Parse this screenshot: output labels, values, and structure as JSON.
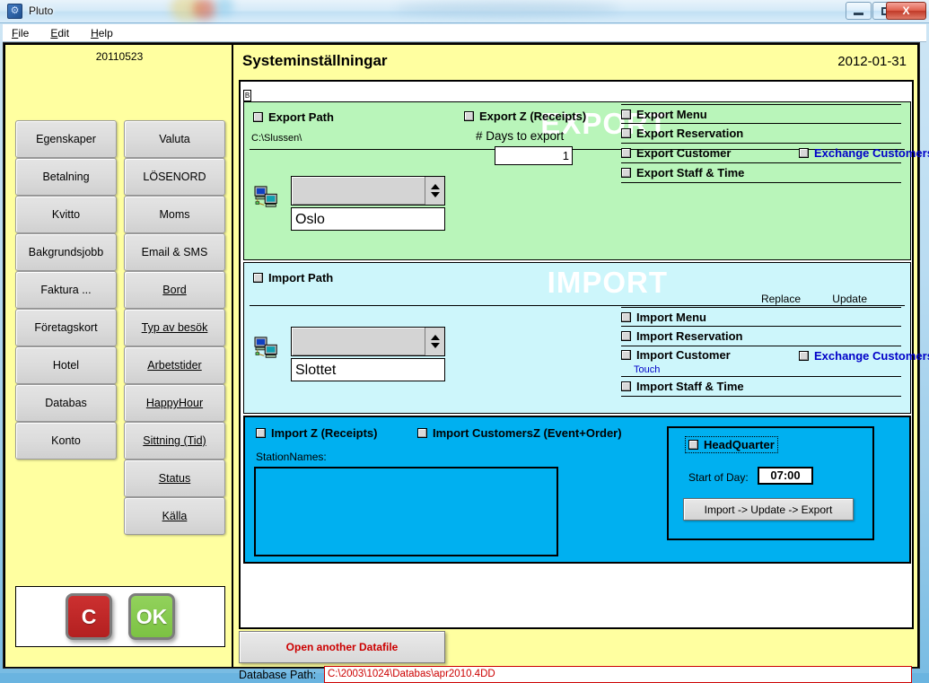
{
  "window": {
    "title": "Pluto",
    "app_icon": "gear-window-icon",
    "minimize": "–",
    "maximize": "□",
    "close": "X"
  },
  "menubar": {
    "items": [
      {
        "label": "File",
        "accel": "F"
      },
      {
        "label": "Edit",
        "accel": "E"
      },
      {
        "label": "Help",
        "accel": "H"
      }
    ]
  },
  "sidebar": {
    "date_code": "20110523",
    "buttons": [
      {
        "label": "Egenskaper",
        "underline": false
      },
      {
        "label": "Valuta",
        "underline": false
      },
      {
        "label": "Betalning",
        "underline": false
      },
      {
        "label": "LÖSENORD",
        "underline": false
      },
      {
        "label": "Kvitto",
        "underline": false
      },
      {
        "label": "Moms",
        "underline": false
      },
      {
        "label": "Bakgrundsjobb",
        "underline": false
      },
      {
        "label": "Email & SMS",
        "underline": false
      },
      {
        "label": "Faktura ...",
        "underline": false
      },
      {
        "label": "Bord",
        "underline": true
      },
      {
        "label": "Företagskort",
        "underline": false
      },
      {
        "label": "Typ av besök",
        "underline": true
      },
      {
        "label": "Hotel",
        "underline": false
      },
      {
        "label": "Arbetstider",
        "underline": true
      },
      {
        "label": "Databas",
        "underline": false
      },
      {
        "label": "HappyHour",
        "underline": true
      },
      {
        "label": "Konto",
        "underline": false
      },
      {
        "label": "Sittning (Tid)",
        "underline": true
      },
      {
        "label": "",
        "underline": false,
        "empty": true
      },
      {
        "label": "Status",
        "underline": true
      },
      {
        "label": "",
        "underline": false,
        "empty": true
      },
      {
        "label": "Källa",
        "underline": true
      }
    ],
    "cancel_button": "C",
    "ok_button": "OK"
  },
  "page": {
    "title": "Systeminställningar",
    "date": "2012-01-31",
    "tab_marker": "B"
  },
  "export": {
    "watermark": "EXPORT",
    "path_checkbox_label": "Export Path",
    "path_value": "C:\\Slussen\\",
    "station_combo_value": "",
    "station_name": "Oslo",
    "network_icon": "network-computers-icon",
    "export_z_label": "Export Z (Receipts)",
    "days_label": "# Days to export",
    "days_value": "1",
    "checklist": [
      {
        "label": "Export Menu",
        "extra": null
      },
      {
        "label": "Export Reservation",
        "extra": null
      },
      {
        "label": "Export Customer",
        "extra": "Exchange Customers"
      },
      {
        "label": "Export Staff & Time",
        "extra": null
      }
    ]
  },
  "import": {
    "watermark": "IMPORT",
    "path_checkbox_label": "Import Path",
    "station_combo_value": "",
    "station_name": "Slottet",
    "network_icon": "network-computers-icon",
    "col_replace": "Replace",
    "col_update": "Update",
    "checklist": [
      {
        "label": "Import Menu",
        "extra": null,
        "note": null
      },
      {
        "label": "Import Reservation",
        "extra": null,
        "note": null
      },
      {
        "label": "Import Customer",
        "extra": "Exchange Customers",
        "note": "Touch"
      },
      {
        "label": "Import Staff & Time",
        "extra": null,
        "note": null
      }
    ]
  },
  "blue_panel": {
    "import_z_label": "Import Z (Receipts)",
    "import_customersz_label": "Import CustomersZ (Event+Order)",
    "station_names_label": "StationNames:",
    "station_names_value": "",
    "headquarter": {
      "checkbox_label": "HeadQuarter",
      "start_of_day_label": "Start of Day:",
      "start_of_day_value": "07:00",
      "action_button": "Import -> Update -> Export"
    }
  },
  "bottom": {
    "open_datafile_button": "Open another Datafile",
    "db_path_label": "Database Path:",
    "db_path_value": "C:\\2003\\1024\\Databas\\apr2010.4DD"
  },
  "colors": {
    "sidebar_bg": "#ffffa0",
    "export_bg": "#b9f5ba",
    "import_bg": "#cdf6fb",
    "blue_bg": "#00b0f0",
    "link_blue": "#0000c8",
    "alert_red": "#cc0000"
  }
}
